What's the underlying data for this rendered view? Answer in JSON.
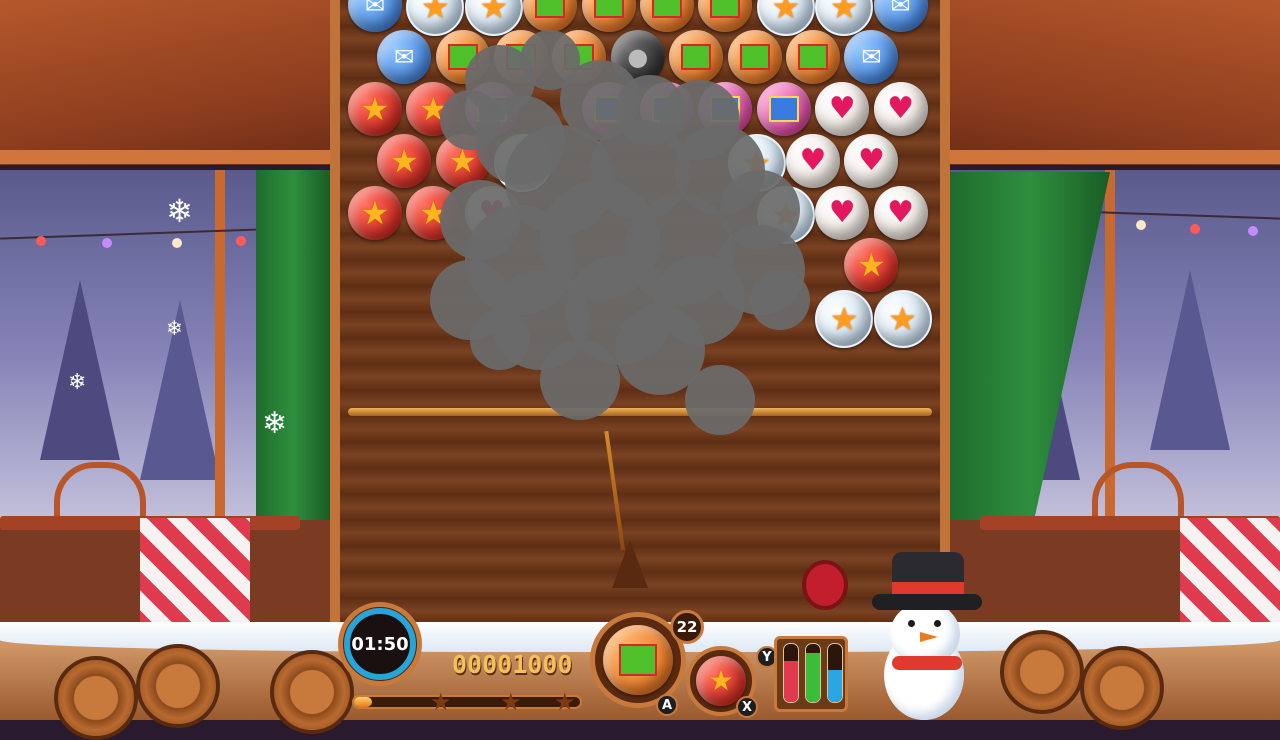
{
  "hud": {
    "timer": "01:50",
    "score": "00001000",
    "shots_remaining": "22",
    "level_progress": 0.08,
    "stars_earned": 0,
    "stars_total": 3,
    "current_bubble": "gift",
    "next_bubble": "star",
    "swap_key": "A",
    "next_key": "X",
    "powerup_key": "Y",
    "power_tubes": [
      {
        "color": "#e03a4e",
        "fill": 0.7
      },
      {
        "color": "#3dbb3a",
        "fill": 0.85
      },
      {
        "color": "#2aa6e0",
        "fill": 0.55
      }
    ]
  },
  "bubble_types": {
    "envelope": "envelope-icon",
    "gift": "gift-icon",
    "gift-pink": "gift-icon",
    "heart": "heart-icon",
    "star": "star-icon",
    "ice": "ice-icon",
    "bomb": "bomb-icon"
  },
  "grid_rows": [
    [
      "envelope",
      "ice",
      "ice",
      "gift",
      "gift",
      "gift",
      "gift",
      "ice",
      "ice",
      "envelope"
    ],
    [
      "envelope",
      "gift",
      "gift",
      "gift",
      "bomb",
      "gift",
      "gift",
      "gift",
      "envelope"
    ],
    [
      "star",
      "star",
      "gift-pink",
      "",
      "gift-pink",
      "gift-pink",
      "gift-pink",
      "gift-pink",
      "heart",
      "heart"
    ],
    [
      "star",
      "star",
      "ice",
      "",
      "",
      "",
      "ice",
      "heart",
      "heart"
    ],
    [
      "star",
      "star",
      "heart",
      "",
      "",
      "",
      "",
      "ice",
      "heart",
      "heart"
    ],
    [
      "",
      "",
      "",
      "",
      "",
      "",
      "",
      "",
      "star"
    ],
    [
      "",
      "",
      "",
      "",
      "",
      "",
      "",
      "",
      "ice",
      "ice"
    ]
  ]
}
